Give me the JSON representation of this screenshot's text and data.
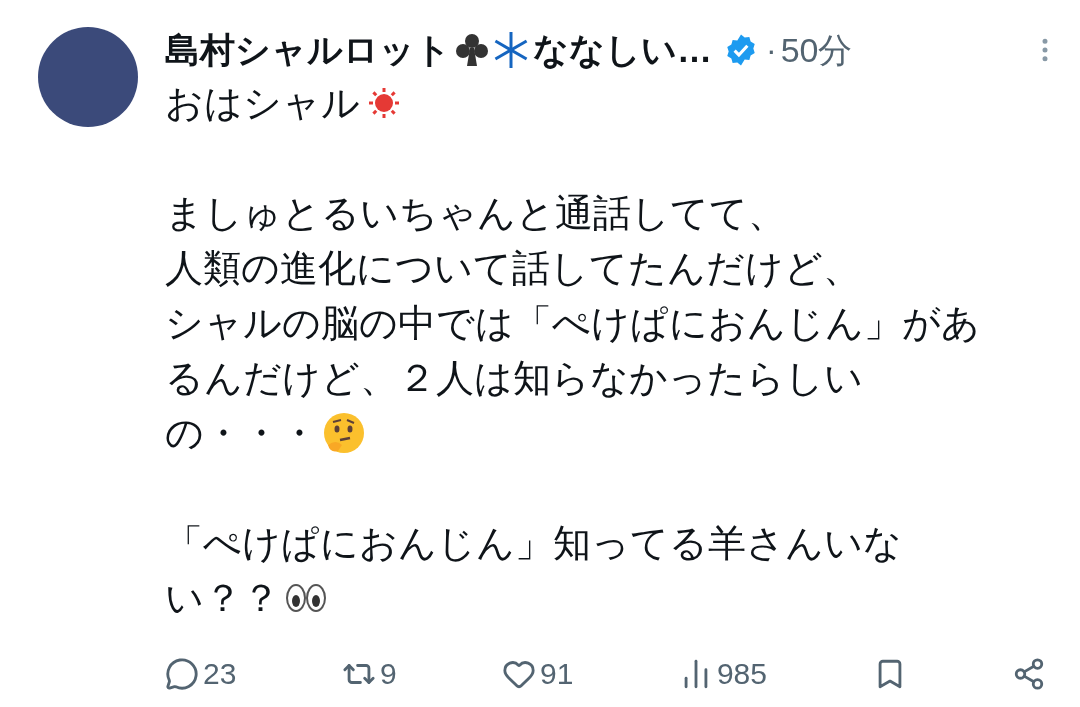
{
  "post": {
    "author_name": "島村シャルロット",
    "author_suffix": "ななしい…",
    "separator": "·",
    "time": "50分",
    "body": [
      {
        "kind": "sun",
        "text": "おはシャル"
      },
      {
        "kind": "blank"
      },
      {
        "kind": "plain",
        "text": "ましゅとるいちゃんと通話してて、"
      },
      {
        "kind": "plain",
        "text": "人類の進化について話してたんだけど、"
      },
      {
        "kind": "plain",
        "text": "シャルの脳の中では「ぺけぱにおんじん」があ"
      },
      {
        "kind": "plain",
        "text": "るんだけど、２人は知らなかったらしい"
      },
      {
        "kind": "thinking",
        "text": "の・・・"
      },
      {
        "kind": "blank"
      },
      {
        "kind": "plain",
        "text": "「ぺけぱにおんじん」知ってる羊さんいな"
      },
      {
        "kind": "eyes",
        "text": "い？？"
      }
    ],
    "actions": [
      {
        "kind": "reply",
        "count": "23"
      },
      {
        "kind": "repost",
        "count": "9"
      },
      {
        "kind": "like",
        "count": "91"
      },
      {
        "kind": "views",
        "count": "985"
      },
      {
        "kind": "bookmark"
      },
      {
        "kind": "share"
      }
    ]
  }
}
